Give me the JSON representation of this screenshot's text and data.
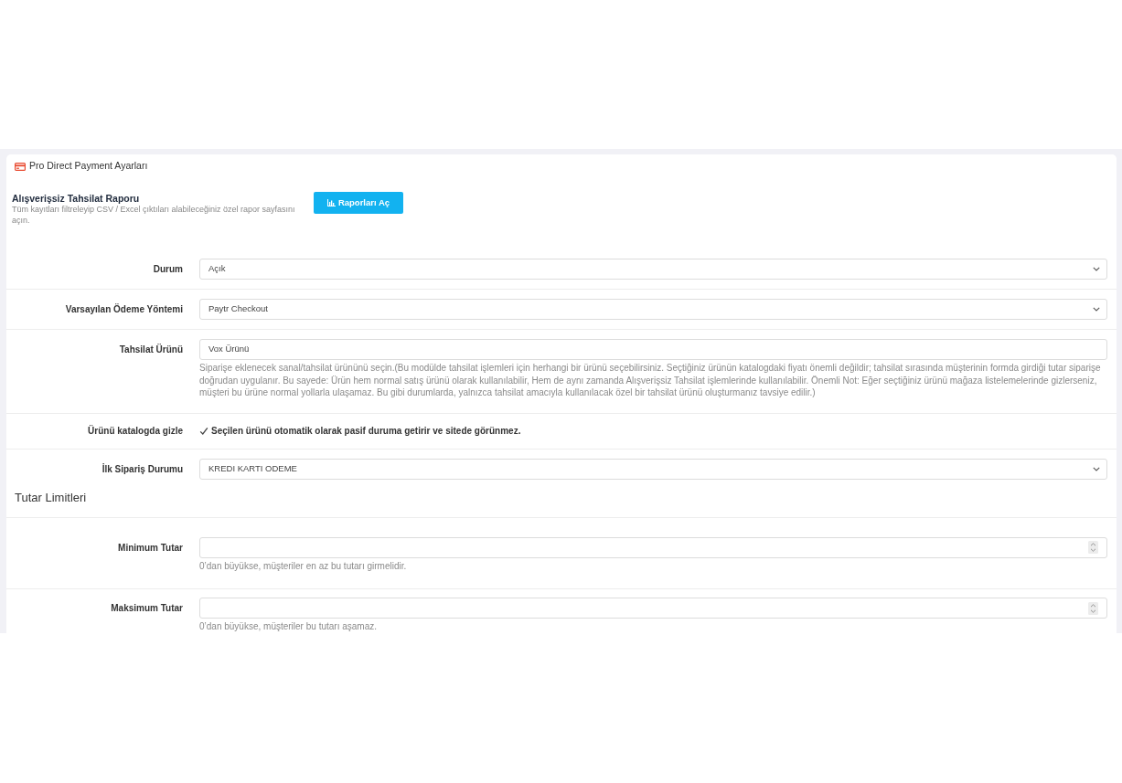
{
  "panel": {
    "title": "Pro Direct Payment Ayarları"
  },
  "report": {
    "title": "Alışverişsiz Tahsilat Raporu",
    "description": "Tüm kayıtları filtreleyip CSV / Excel çıktıları alabileceğiniz özel rapor sayfasını açın.",
    "button": "Raporları Aç"
  },
  "fields": [
    {
      "kind": "select",
      "label": "Durum",
      "value": "Açık"
    },
    {
      "kind": "select",
      "label": "Varsayılan Ödeme Yöntemi",
      "value": "Paytr Checkout"
    },
    {
      "kind": "text",
      "label": "Tahsilat Ürünü",
      "value": "Vox Ürünü",
      "help": "Siparişe eklenecek sanal/tahsilat ürününü seçin.(Bu modülde tahsilat işlemleri için herhangi bir ürünü seçebilirsiniz. Seçtiğiniz ürünün katalogdaki fiyatı önemli değildir; tahsilat sırasında müşterinin formda girdiği tutar siparişe doğrudan uygulanır. Bu sayede: Ürün hem normal satış ürünü olarak kullanılabilir, Hem de aynı zamanda Alışverişsiz Tahsilat işlemlerinde kullanılabilir. Önemli Not: Eğer seçtiğiniz ürünü mağaza listelemelerinde gizlerseniz, müşteri bu ürüne normal yollarla ulaşamaz. Bu gibi durumlarda, yalnızca tahsilat amacıyla kullanılacak özel bir tahsilat ürünü oluşturmanız tavsiye edilir.)"
    },
    {
      "kind": "checkbox",
      "label": "Ürünü katalogda gizle",
      "checked": true,
      "text": "Seçilen ürünü otomatik olarak pasif duruma getirir ve sitede görünmez."
    },
    {
      "kind": "select",
      "label": "İlk Sipariş Durumu",
      "value": "KREDI KARTI ODEME"
    }
  ],
  "limits": {
    "title": "Tutar Limitleri",
    "fields": [
      {
        "kind": "number",
        "label": "Minimum Tutar",
        "help": "0’dan büyükse, müşteriler en az bu tutarı girmelidir."
      },
      {
        "kind": "number",
        "label": "Maksimum Tutar",
        "help": "0’dan büyükse, müşteriler bu tutarı aşamaz."
      }
    ]
  }
}
